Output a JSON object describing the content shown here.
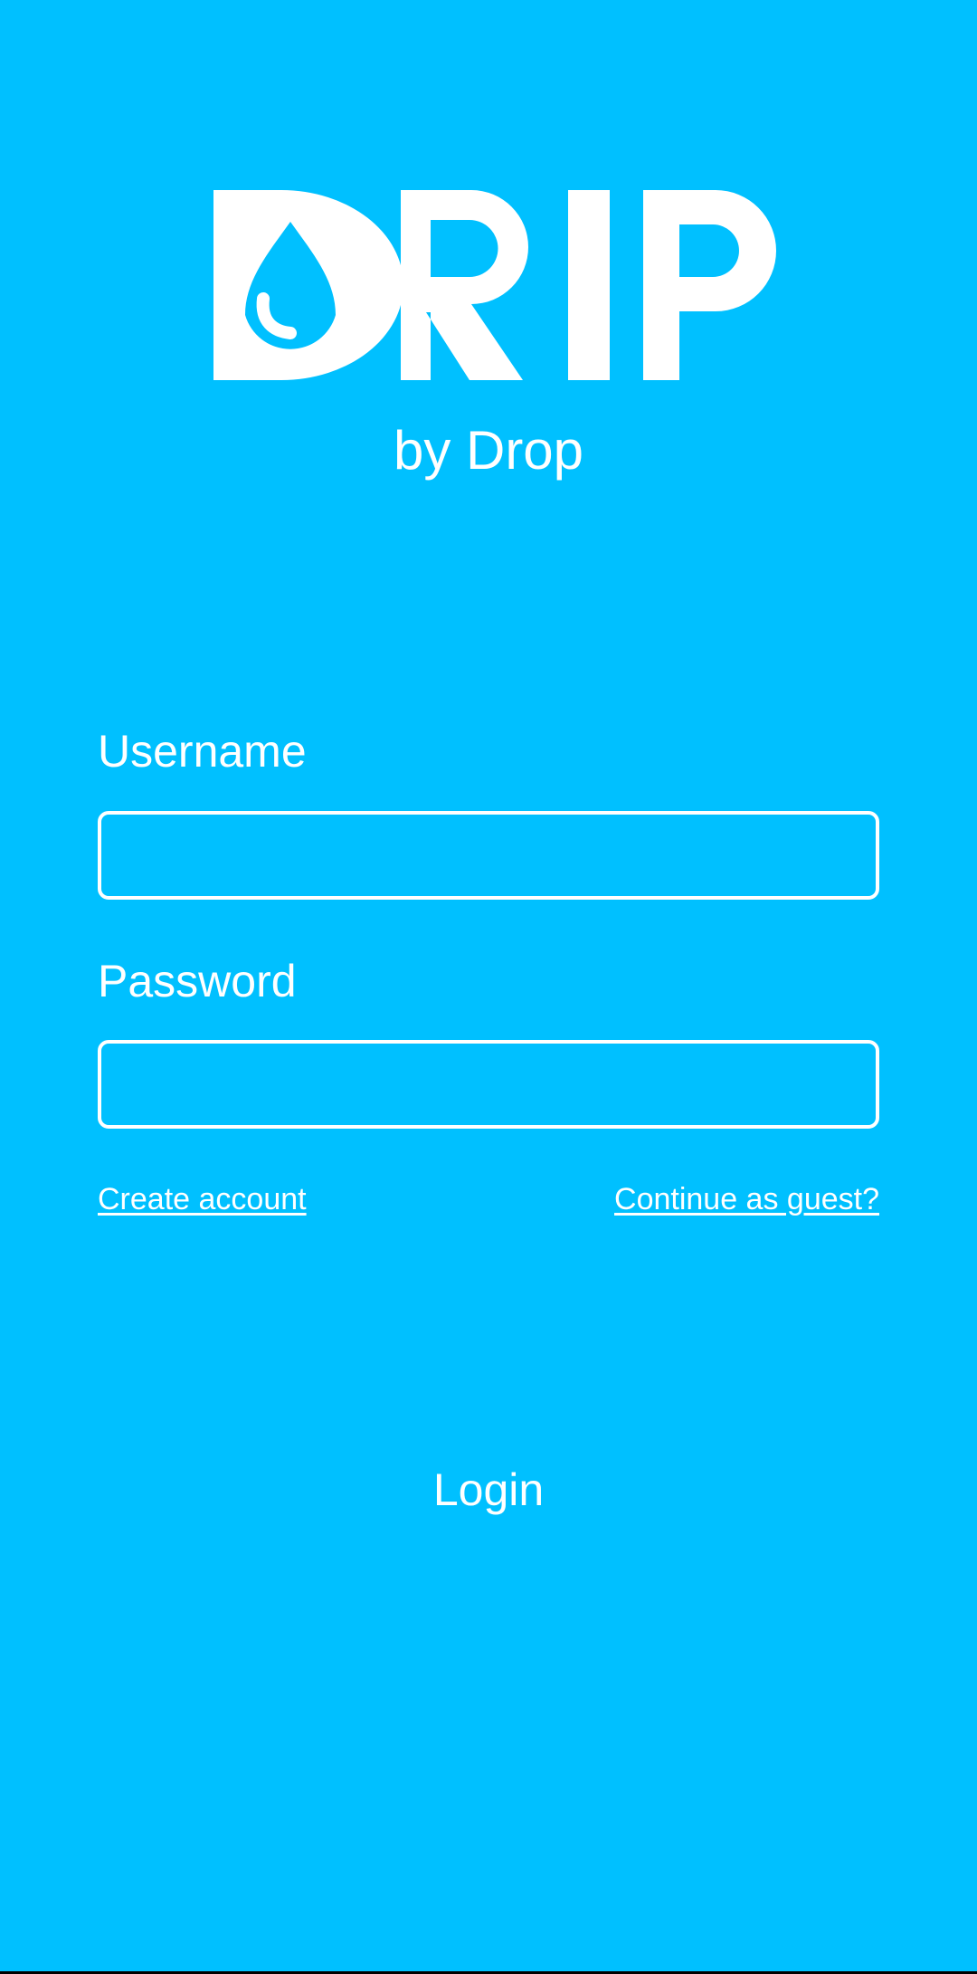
{
  "app": {
    "logo_text": "DRIP",
    "tagline": "by Drop"
  },
  "form": {
    "username_label": "Username",
    "username_value": "",
    "password_label": "Password",
    "password_value": ""
  },
  "links": {
    "create_account": "Create account",
    "continue_guest": "Continue as guest?"
  },
  "actions": {
    "login_label": "Login"
  },
  "colors": {
    "background": "#00c0ff",
    "foreground": "#ffffff"
  },
  "icons": {
    "logo_mark": "water-drop-icon"
  }
}
